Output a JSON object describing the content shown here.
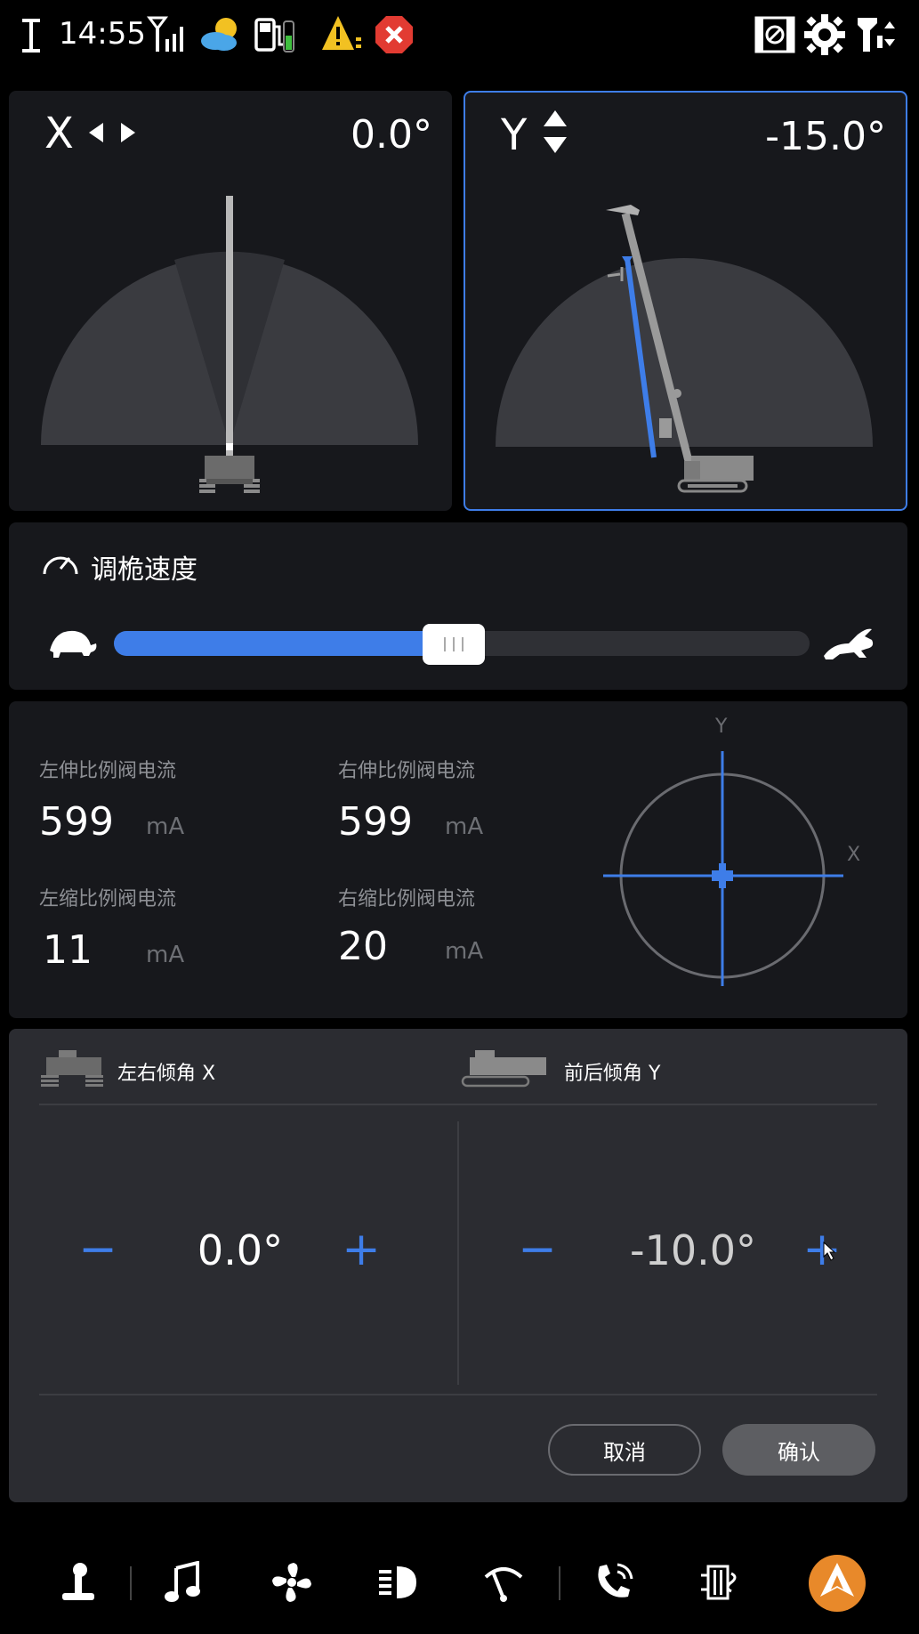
{
  "status_bar": {
    "time": "14:55",
    "icons": [
      "text-cursor-icon",
      "signal-icon",
      "weather-icon",
      "fuel-icon",
      "battery-icon",
      "warning-icon",
      "error-icon",
      "media-off-icon",
      "settings-gear-icon",
      "tool-switch-icon"
    ],
    "colors": {
      "warning": "#f2c122",
      "error": "#e23b32",
      "battery": "#3fbf3f"
    }
  },
  "x_panel": {
    "axis": "X",
    "value": "0.0°"
  },
  "y_panel": {
    "axis": "Y",
    "value": "-15.0°"
  },
  "speed": {
    "title": "调桅速度",
    "level_percent": 52,
    "slow_icon": "turtle-icon",
    "fast_icon": "rabbit-icon"
  },
  "currents": {
    "left_extend": {
      "label": "左伸比例阀电流",
      "value": "599",
      "unit": "mA"
    },
    "right_extend": {
      "label": "右伸比例阀电流",
      "value": "599",
      "unit": "mA"
    },
    "left_retract": {
      "label": "左缩比例阀电流",
      "value": "11",
      "unit": "mA"
    },
    "right_retract": {
      "label": "右缩比例阀电流",
      "value": "20",
      "unit": "mA"
    }
  },
  "crosshair": {
    "x_label": "X",
    "y_label": "Y"
  },
  "adjust": {
    "x": {
      "label": "左右倾角 X",
      "value": "0.0°",
      "minus": "−",
      "plus": "+"
    },
    "y": {
      "label": "前后倾角 Y",
      "value": "-10.0°",
      "minus": "−",
      "plus": "+"
    },
    "cancel": "取消",
    "confirm": "确认"
  },
  "bottom_nav": [
    "joystick-icon",
    "music-icon",
    "fan-icon",
    "headlight-icon",
    "wiper-icon",
    "phone-icon",
    "heater-icon",
    "brand-logo-icon"
  ],
  "colors": {
    "accent": "#3e7de8",
    "brand": "#e8892a",
    "panel": "#17181c",
    "panel_light": "#2b2c31"
  }
}
